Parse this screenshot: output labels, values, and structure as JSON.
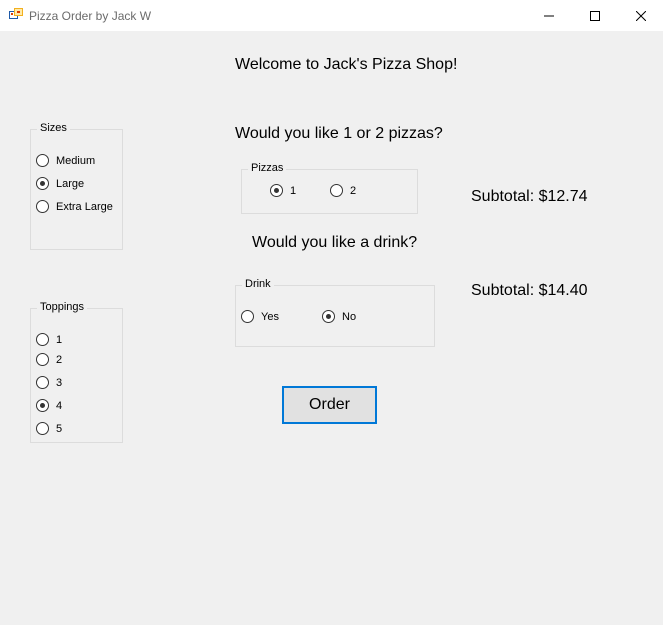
{
  "window": {
    "title": "Pizza Order by Jack W"
  },
  "content": {
    "welcome": "Welcome to Jack's Pizza Shop!",
    "pizza_question": "Would you like 1 or 2 pizzas?",
    "drink_question": "Would you like a drink?",
    "pizza_subtotal": "Subtotal: $12.74",
    "drink_subtotal": "Subtotal: $14.40",
    "order_button": "Order"
  },
  "sizes": {
    "title": "Sizes",
    "options": [
      {
        "label": "Medium",
        "checked": false
      },
      {
        "label": "Large",
        "checked": true
      },
      {
        "label": "Extra Large",
        "checked": false
      }
    ]
  },
  "toppings": {
    "title": "Toppings",
    "options": [
      {
        "label": "1",
        "checked": false
      },
      {
        "label": "2",
        "checked": false
      },
      {
        "label": "3",
        "checked": false
      },
      {
        "label": "4",
        "checked": true
      },
      {
        "label": "5",
        "checked": false
      }
    ]
  },
  "pizzas": {
    "title": "Pizzas",
    "options": [
      {
        "label": "1",
        "checked": true
      },
      {
        "label": "2",
        "checked": false
      }
    ]
  },
  "drink": {
    "title": "Drink",
    "options": [
      {
        "label": "Yes",
        "checked": false
      },
      {
        "label": "No",
        "checked": true
      }
    ]
  }
}
